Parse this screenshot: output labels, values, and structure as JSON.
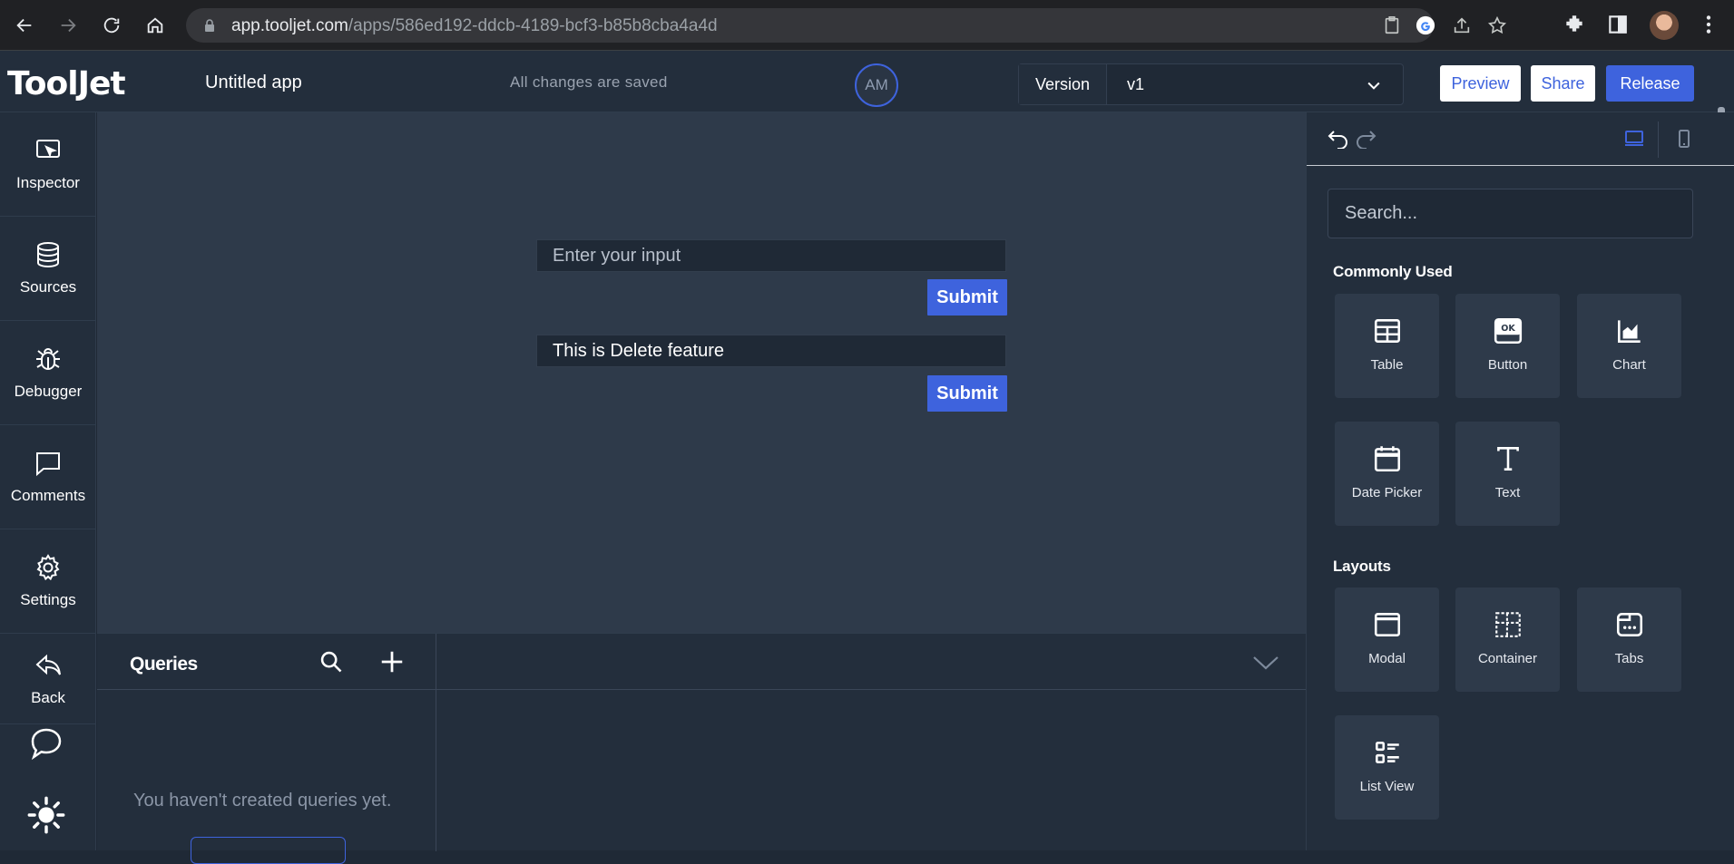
{
  "browser": {
    "url_host": "app.tooljet.com",
    "url_path": "/apps/586ed192-ddcb-4189-bcf3-b85b8cba4a4d"
  },
  "header": {
    "logo": "ToolJet",
    "app_name": "Untitled app",
    "save_status": "All changes are saved",
    "user_initials": "AM",
    "version_label": "Version",
    "version_value": "v1",
    "preview_label": "Preview",
    "share_label": "Share",
    "release_label": "Release"
  },
  "sidebar": {
    "items": [
      {
        "label": "Inspector",
        "icon": "inspector-icon"
      },
      {
        "label": "Sources",
        "icon": "database-icon"
      },
      {
        "label": "Debugger",
        "icon": "bug-icon"
      },
      {
        "label": "Comments",
        "icon": "comment-icon"
      },
      {
        "label": "Settings",
        "icon": "gear-icon"
      },
      {
        "label": "Back",
        "icon": "back-arrow-icon"
      }
    ]
  },
  "canvas": {
    "input1_placeholder": "Enter your input",
    "submit1_label": "Submit",
    "input2_value": "This is Delete feature",
    "submit2_label": "Submit"
  },
  "queries": {
    "title": "Queries",
    "empty_text": "You haven't created queries yet."
  },
  "widgets": {
    "search_placeholder": "Search...",
    "common_title": "Commonly Used",
    "common": [
      {
        "label": "Table",
        "icon": "table-icon"
      },
      {
        "label": "Button",
        "icon": "button-icon"
      },
      {
        "label": "Chart",
        "icon": "chart-icon"
      },
      {
        "label": "Date Picker",
        "icon": "calendar-icon"
      },
      {
        "label": "Text",
        "icon": "text-icon"
      }
    ],
    "layouts_title": "Layouts",
    "layouts": [
      {
        "label": "Modal",
        "icon": "modal-icon"
      },
      {
        "label": "Container",
        "icon": "container-icon"
      },
      {
        "label": "Tabs",
        "icon": "tabs-icon"
      },
      {
        "label": "List View",
        "icon": "list-view-icon"
      }
    ]
  },
  "colors": {
    "accent": "#3e63dd",
    "panel": "#232e3c",
    "canvas": "#2e3a4a"
  }
}
